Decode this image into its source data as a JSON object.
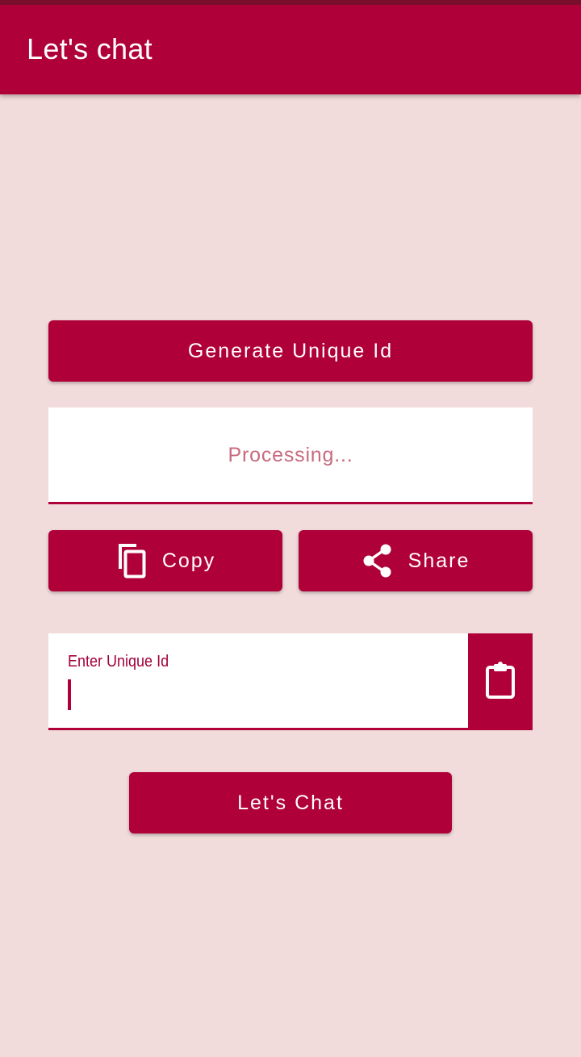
{
  "app_bar": {
    "title": "Let's chat"
  },
  "generate": {
    "label": "Generate Unique Id"
  },
  "id_display": {
    "text": "Processing..."
  },
  "copy": {
    "label": "Copy",
    "icon": "copy-icon"
  },
  "share": {
    "label": "Share",
    "icon": "share-icon"
  },
  "unique_id_input": {
    "label": "Enter Unique Id",
    "value": ""
  },
  "paste": {
    "icon": "clipboard-icon"
  },
  "chat": {
    "label": "Let's Chat"
  },
  "colors": {
    "primary": "#b0003a",
    "status_bar": "#7a0f2c",
    "background": "#f2dcdb",
    "placeholder_text": "#c96a7f"
  }
}
